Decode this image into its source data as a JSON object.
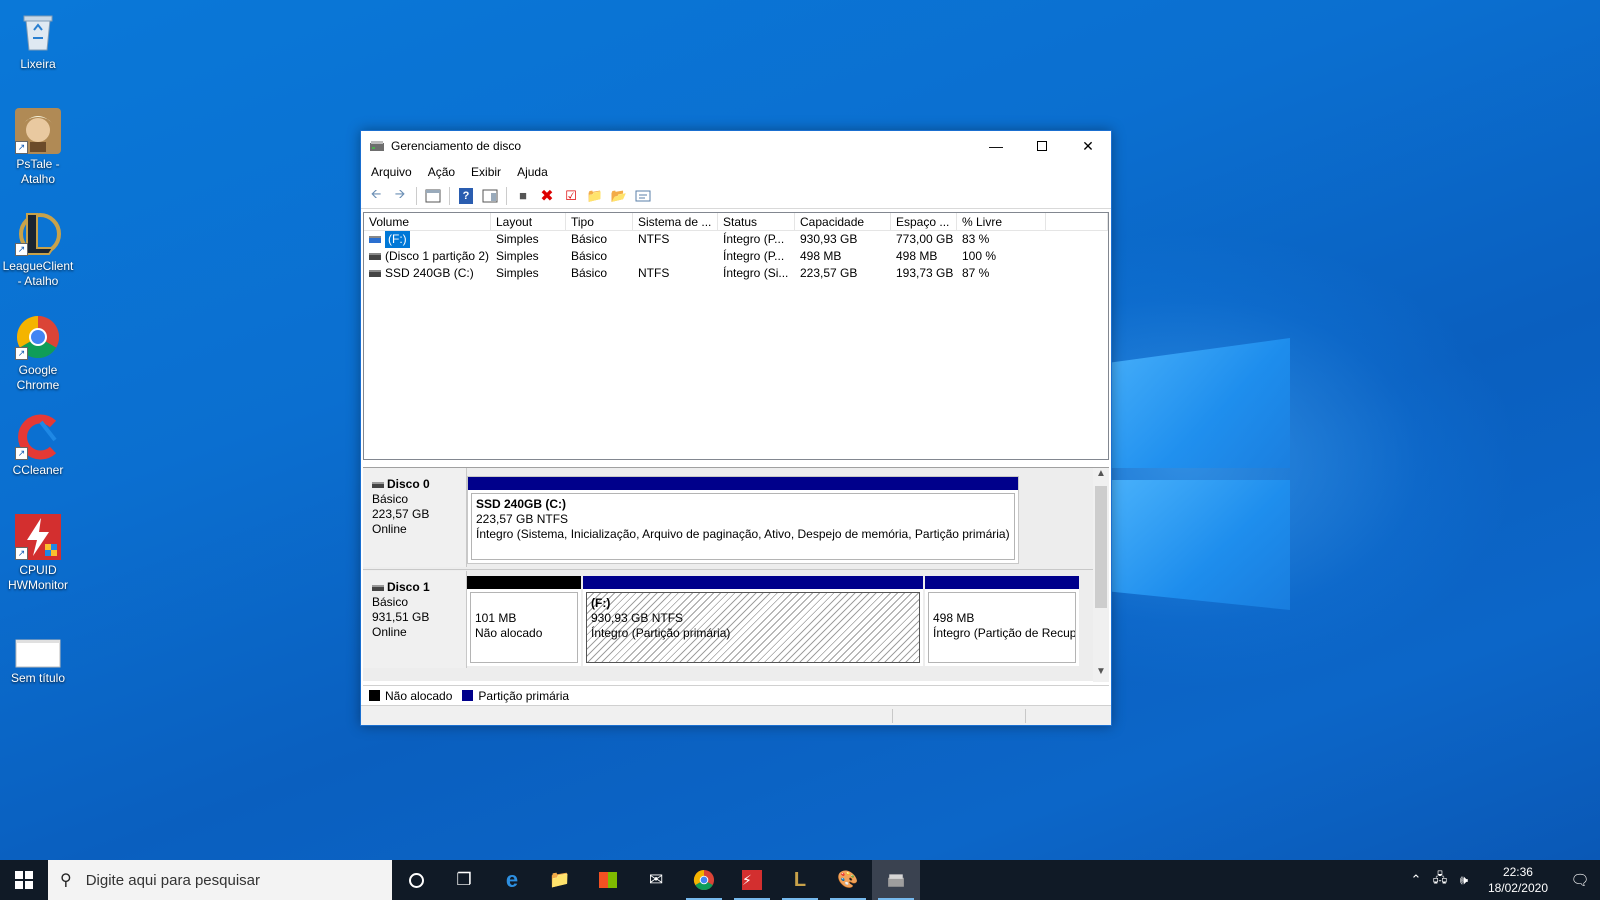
{
  "desktop": {
    "icons": [
      {
        "label": "Lixeira",
        "icon": "recycle-bin-icon"
      },
      {
        "label": "PsTale - Atalho",
        "icon": "game-icon"
      },
      {
        "label": "LeagueClient - Atalho",
        "icon": "league-icon"
      },
      {
        "label": "Google Chrome",
        "icon": "chrome-icon"
      },
      {
        "label": "CCleaner",
        "icon": "ccleaner-icon"
      },
      {
        "label": "CPUID HWMonitor",
        "icon": "hwmonitor-icon"
      },
      {
        "label": "Sem título",
        "icon": "document-icon"
      }
    ]
  },
  "window": {
    "title": "Gerenciamento de disco",
    "menu": [
      "Arquivo",
      "Ação",
      "Exibir",
      "Ajuda"
    ],
    "columns": [
      "Volume",
      "Layout",
      "Tipo",
      "Sistema de ...",
      "Status",
      "Capacidade",
      "Espaço ...",
      "% Livre"
    ],
    "rows": [
      {
        "volume": "(F:)",
        "layout": "Simples",
        "tipo": "Básico",
        "fs": "NTFS",
        "status": "Íntegro (P...",
        "cap": "930,93 GB",
        "free": "773,00 GB",
        "pct": "83 %",
        "selected": true
      },
      {
        "volume": "(Disco 1 partição 2)",
        "layout": "Simples",
        "tipo": "Básico",
        "fs": "",
        "status": "Íntegro (P...",
        "cap": "498 MB",
        "free": "498 MB",
        "pct": "100 %"
      },
      {
        "volume": "SSD 240GB (C:)",
        "layout": "Simples",
        "tipo": "Básico",
        "fs": "NTFS",
        "status": "Íntegro (Si...",
        "cap": "223,57 GB",
        "free": "193,73 GB",
        "pct": "87 %"
      }
    ],
    "disks": [
      {
        "name": "Disco 0",
        "type": "Básico",
        "size": "223,57 GB",
        "state": "Online",
        "partitions": [
          {
            "title": "SSD 240GB  (C:)",
            "line2": "223,57 GB NTFS",
            "line3": "Íntegro (Sistema, Inicialização, Arquivo de paginação, Ativo, Despejo de memória, Partição primária)",
            "kind": "primary"
          }
        ]
      },
      {
        "name": "Disco 1",
        "type": "Básico",
        "size": "931,51 GB",
        "state": "Online",
        "partitions": [
          {
            "title": "",
            "line2": "101 MB",
            "line3": "Não alocado",
            "kind": "unallocated"
          },
          {
            "title": "(F:)",
            "line2": "930,93 GB NTFS",
            "line3": "Íntegro (Partição primária)",
            "kind": "primary-selected"
          },
          {
            "title": "",
            "line2": "498 MB",
            "line3": "Íntegro (Partição de Recupe",
            "kind": "primary"
          }
        ]
      }
    ],
    "legend": [
      {
        "label": "Não alocado",
        "color": "#000000"
      },
      {
        "label": "Partição primária",
        "color": "#00008b"
      }
    ]
  },
  "taskbar": {
    "search_placeholder": "Digite aqui para pesquisar",
    "time": "22:36",
    "date": "18/02/2020"
  }
}
